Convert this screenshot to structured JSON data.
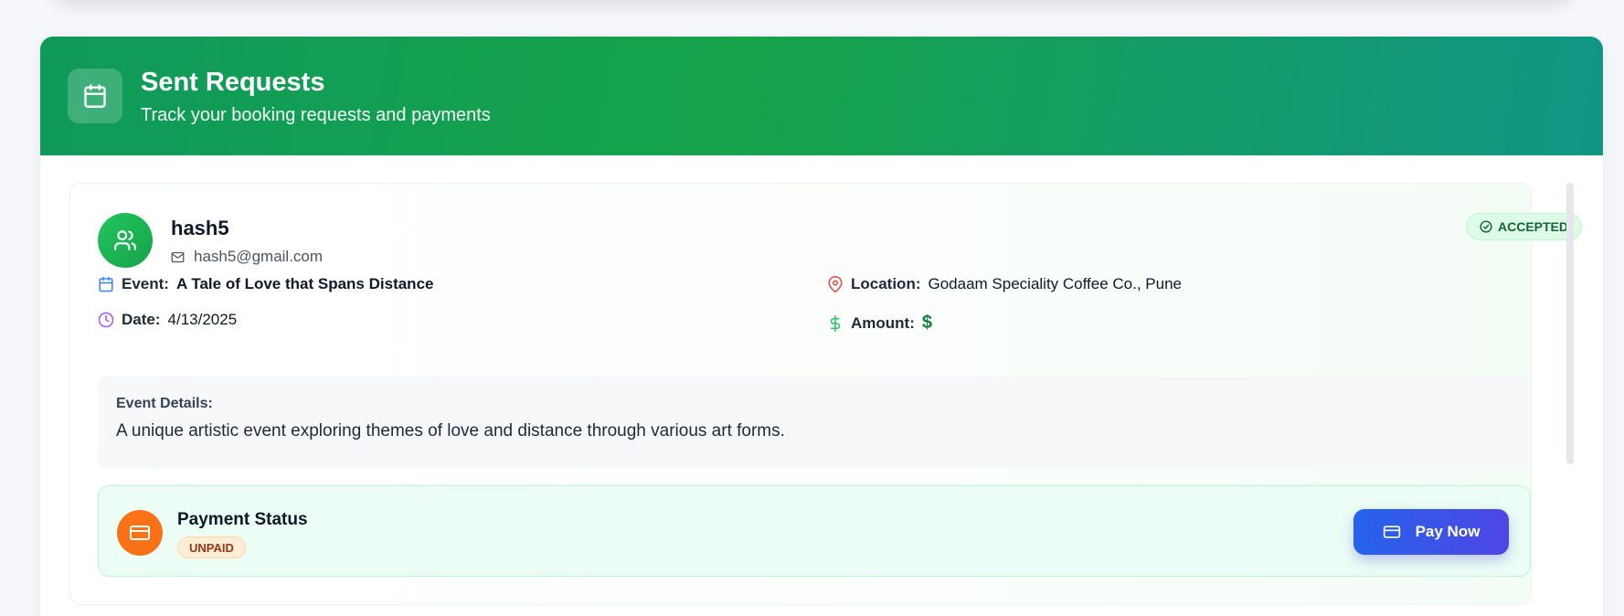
{
  "header": {
    "title": "Sent Requests",
    "subtitle": "Track your booking requests and payments",
    "icon": "calendar-icon"
  },
  "request": {
    "user_name": "hash5",
    "user_email": "hash5@gmail.com",
    "status": "ACCEPTED",
    "event_label": "Event:",
    "event_value": "A Tale of Love that Spans Distance",
    "date_label": "Date:",
    "date_value": "4/13/2025",
    "location_label": "Location:",
    "location_value": "Godaam Speciality Coffee Co., Pune",
    "amount_label": "Amount:",
    "amount_value": "$",
    "details_label": "Event Details:",
    "details_text": "A unique artistic event exploring themes of love and distance through various art forms."
  },
  "payment": {
    "title": "Payment Status",
    "status": "UNPAID",
    "button_label": "Pay Now"
  },
  "colors": {
    "header_gradient_start": "#0f9a5b",
    "header_gradient_end": "#109585",
    "accent_green": "#16a34a",
    "pay_button": "#4f46e5",
    "payment_icon": "#f97316",
    "calendar_icon": "#3b82f6",
    "clock_icon": "#a855f7",
    "location_icon": "#ef4444",
    "dollar_icon": "#22c55e"
  }
}
